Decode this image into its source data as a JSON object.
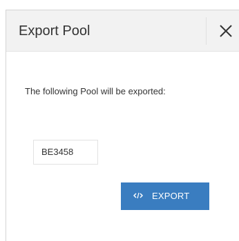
{
  "dialog": {
    "title": "Export Pool",
    "close_icon": "close-icon",
    "message": "The following Pool will be exported:",
    "pool": {
      "name": "BE3458"
    },
    "export_button": {
      "label": "EXPORT",
      "icon": "code-icon"
    }
  },
  "colors": {
    "header_bg": "#f2f2f2",
    "primary_button": "#3a7dc0",
    "text": "#333333"
  }
}
